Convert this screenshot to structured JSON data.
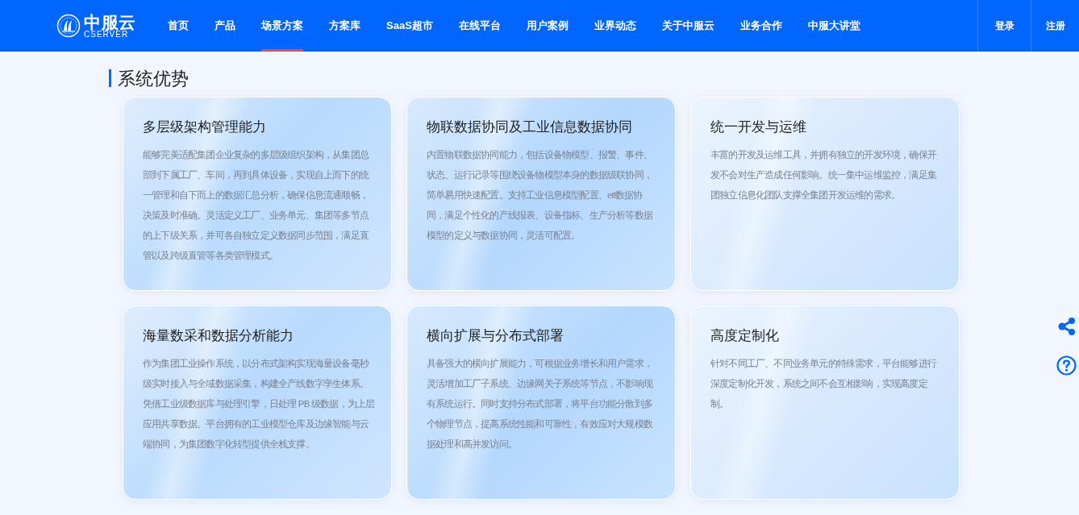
{
  "logo": {
    "name": "中服云",
    "subtitle": "CSERVER"
  },
  "nav": [
    {
      "label": "首页",
      "selected": false
    },
    {
      "label": "产品",
      "selected": false
    },
    {
      "label": "场景方案",
      "selected": true
    },
    {
      "label": "方案库",
      "selected": false
    },
    {
      "label": "SaaS超市",
      "selected": false
    },
    {
      "label": "在线平台",
      "selected": false
    },
    {
      "label": "用户案例",
      "selected": false
    },
    {
      "label": "业界动态",
      "selected": false
    },
    {
      "label": "关于中服云",
      "selected": false
    },
    {
      "label": "业务合作",
      "selected": false
    },
    {
      "label": "中服大讲堂",
      "selected": false
    }
  ],
  "auth": [
    "登录",
    "注册"
  ],
  "section_title": "系统优势",
  "cards": [
    {
      "title": "多层级架构管理能力",
      "text": "能够完美适配集团企业复杂的多层级组织架构，从集团总部到下属工厂、车间，再到具体设备，实现自上而下的统一管理和自下而上的数据汇总分析，确保信息流通顺畅，决策及时准确。灵活定义工厂、业务单元、集团等多节点的上下级关系，并可各自独立定义数据同步范围，满足直管以及跨级直管等各类管理模式。"
    },
    {
      "title": "物联数据协同及工业信息数据协同",
      "text": "内置物联数据协同能力，包括设备物模型、报警、事件、状态、运行记录等围绕设备物模型本身的数据级联协同，简单易用快速配置。支持工业信息模型配置、etl数据协同，满足个性化的产线报表、设备指标、生产分析等数据模型的定义与数据协同，灵活可配置。"
    },
    {
      "title": "统一开发与运维",
      "text": "丰富的开发及运维工具，并拥有独立的开发环境，确保开发不会对生产造成任何影响。统一集中运维监控，满足集团独立信息化团队支撑全集团开发运维的需求。"
    },
    {
      "title": "海量数采和数据分析能力",
      "text": "作为集团工业操作系统，以分布式架构实现海量设备毫秒级实时接入与全域数据采集，构建全产线数字孪生体系。凭借工业级数据库与处理引擎，日处理 PB 级数据，为上层应用共享数据。平台拥有的工业模型仓库及边缘智能与云端协同，为集团数字化转型提供全栈支撑。"
    },
    {
      "title": "横向扩展与分布式部署",
      "text": "具备强大的横向扩展能力，可根据业务增长和用户需求，灵活增加工厂子系统、边缘网关子系统等节点，不影响现有系统运行。同时支持分布式部署，将平台功能分散到多个物理节点，提高系统性能和可靠性，有效应对大规模数据处理和高并发访问。"
    },
    {
      "title": "高度定制化",
      "text": "针对不同工厂、不同业务单元的特殊需求，平台能够进行深度定制化开发，系统之间不会互相影响，实现高度定制。"
    }
  ]
}
